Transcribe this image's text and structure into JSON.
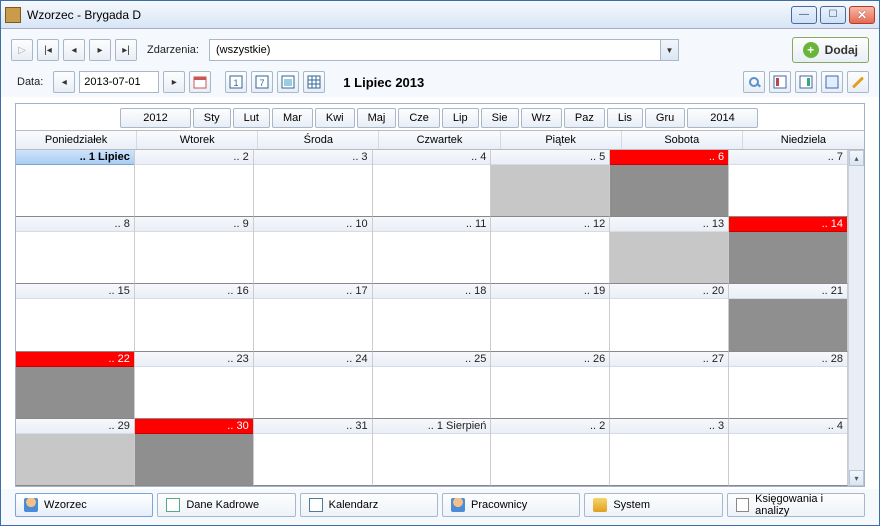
{
  "window": {
    "title": "Wzorzec - Brygada D"
  },
  "toolbar": {
    "events_label": "Zdarzenia:",
    "events_filter": "(wszystkie)",
    "add_label": "Dodaj",
    "date_label": "Data:",
    "date_value": "2013-07-01",
    "month_title": "1 Lipiec 2013"
  },
  "yearbar": {
    "prev_year": "2012",
    "months": [
      "Sty",
      "Lut",
      "Mar",
      "Kwi",
      "Maj",
      "Cze",
      "Lip",
      "Sie",
      "Wrz",
      "Paz",
      "Lis",
      "Gru"
    ],
    "next_year": "2014"
  },
  "day_names": [
    "Poniedziałek",
    "Wtorek",
    "Środa",
    "Czwartek",
    "Piątek",
    "Sobota",
    "Niedziela"
  ],
  "cells": [
    {
      "label": ".. 1 Lipiec",
      "style": "selected"
    },
    {
      "label": ".. 2",
      "style": ""
    },
    {
      "label": ".. 3",
      "style": ""
    },
    {
      "label": ".. 4",
      "style": ""
    },
    {
      "label": ".. 5",
      "style": "lgray"
    },
    {
      "label": ".. 6",
      "style": "red gray"
    },
    {
      "label": ".. 7",
      "style": ""
    },
    {
      "label": ".. 8",
      "style": ""
    },
    {
      "label": ".. 9",
      "style": ""
    },
    {
      "label": ".. 10",
      "style": ""
    },
    {
      "label": ".. 11",
      "style": ""
    },
    {
      "label": ".. 12",
      "style": ""
    },
    {
      "label": ".. 13",
      "style": "lgray"
    },
    {
      "label": ".. 14",
      "style": "red gray"
    },
    {
      "label": ".. 15",
      "style": ""
    },
    {
      "label": ".. 16",
      "style": ""
    },
    {
      "label": ".. 17",
      "style": ""
    },
    {
      "label": ".. 18",
      "style": ""
    },
    {
      "label": ".. 19",
      "style": ""
    },
    {
      "label": ".. 20",
      "style": ""
    },
    {
      "label": ".. 21",
      "style": "gray"
    },
    {
      "label": ".. 22",
      "style": "red gray"
    },
    {
      "label": ".. 23",
      "style": ""
    },
    {
      "label": ".. 24",
      "style": ""
    },
    {
      "label": ".. 25",
      "style": ""
    },
    {
      "label": ".. 26",
      "style": ""
    },
    {
      "label": ".. 27",
      "style": ""
    },
    {
      "label": ".. 28",
      "style": ""
    },
    {
      "label": ".. 29",
      "style": "lgray"
    },
    {
      "label": ".. 30",
      "style": "red gray"
    },
    {
      "label": ".. 31",
      "style": ""
    },
    {
      "label": ".. 1 Sierpień",
      "style": ""
    },
    {
      "label": ".. 2",
      "style": ""
    },
    {
      "label": ".. 3",
      "style": ""
    },
    {
      "label": ".. 4",
      "style": ""
    }
  ],
  "tabs": {
    "wzorzec": "Wzorzec",
    "dane": "Dane Kadrowe",
    "kalendarz": "Kalendarz",
    "pracownicy": "Pracownicy",
    "system": "System",
    "ksiegowania": "Księgowania i analizy"
  }
}
